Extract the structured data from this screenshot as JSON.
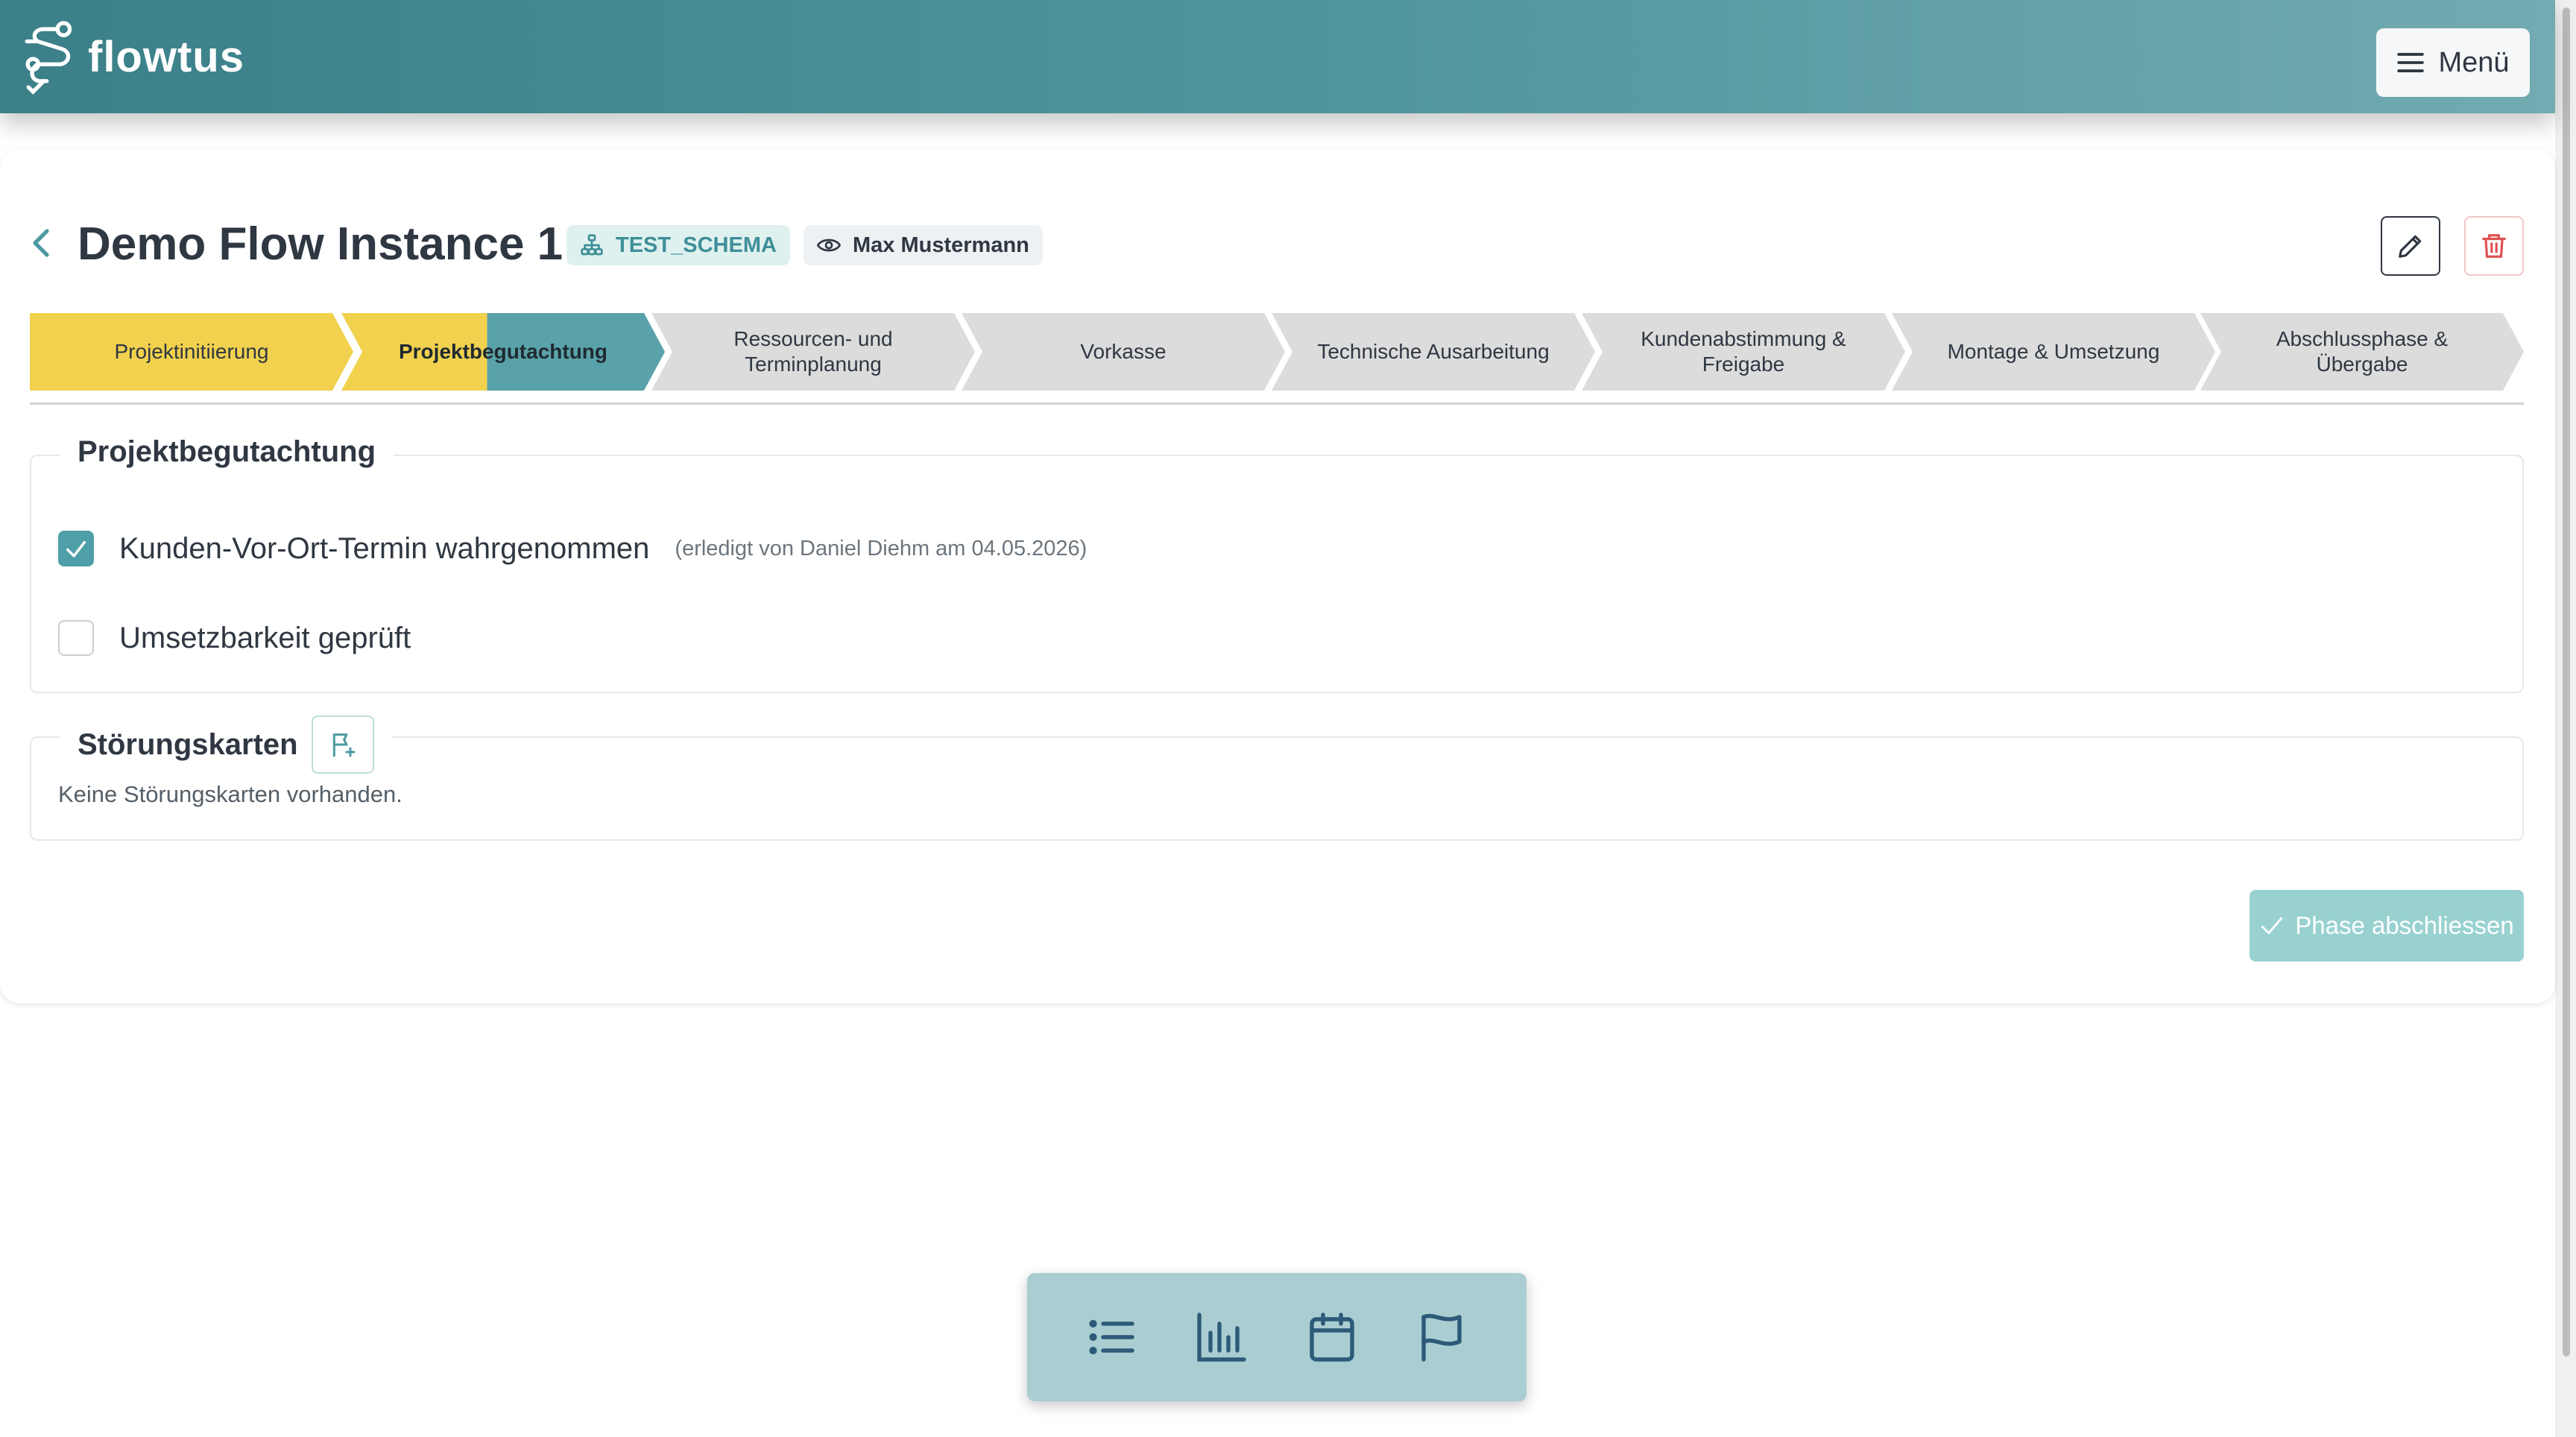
{
  "header": {
    "brand": "flowtus",
    "menu_label": "Menü"
  },
  "page": {
    "title": "Demo Flow Instance 1",
    "schema_tag": "TEST_SCHEMA",
    "watcher_tag": "Max Mustermann"
  },
  "phases": [
    {
      "label": "Projektinitiierung",
      "status": "done"
    },
    {
      "label": "Projektbegutachtung",
      "status": "current"
    },
    {
      "label": "Ressourcen- und Terminplanung",
      "status": "open"
    },
    {
      "label": "Vorkasse",
      "status": "open"
    },
    {
      "label": "Technische Ausarbeitung",
      "status": "open"
    },
    {
      "label": "Kundenabstimmung & Freigabe",
      "status": "open"
    },
    {
      "label": "Montage & Umsetzung",
      "status": "open"
    },
    {
      "label": "Abschlussphase & Übergabe",
      "status": "open"
    }
  ],
  "phase_section": {
    "title": "Projektbegutachtung",
    "tasks": [
      {
        "label": "Kunden-Vor-Ort-Termin wahrgenommen",
        "checked": true,
        "meta": "(erledigt von Daniel Diehm am 04.05.2026)"
      },
      {
        "label": "Umsetzbarkeit geprüft",
        "checked": false,
        "meta": ""
      }
    ]
  },
  "disruptions": {
    "title": "Störungskarten",
    "empty_text": "Keine Störungskarten vorhanden."
  },
  "actions": {
    "finish_phase": "Phase abschliessen"
  },
  "dock": {
    "items": [
      "list-icon",
      "chart-icon",
      "calendar-icon",
      "flag-icon"
    ]
  },
  "colors": {
    "header_start": "#3b7f88",
    "header_end": "#72abb1",
    "phase_done": "#f1d14d",
    "phase_current_accent": "#5aa2aa",
    "phase_open": "#dcdcdc",
    "primary": "#4f9fa8",
    "finish_button": "#98d1d0",
    "dock": "#aacdd1"
  }
}
